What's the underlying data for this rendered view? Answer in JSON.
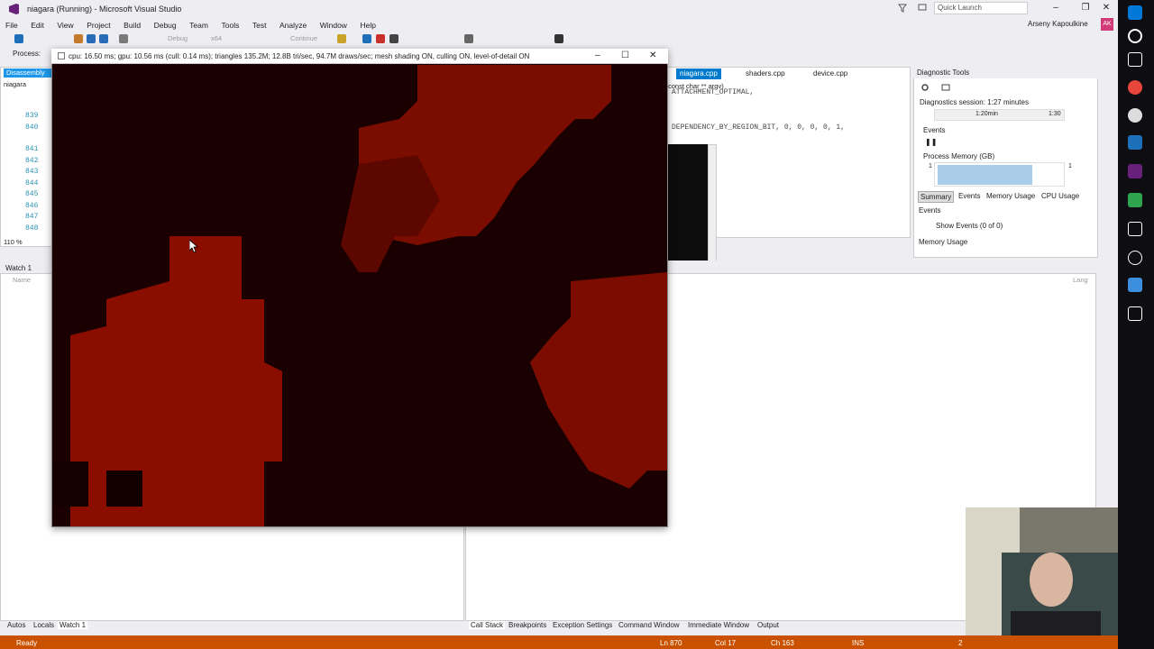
{
  "window": {
    "title": "niagara (Running) - Microsoft Visual Studio",
    "quick_launch": "Quick Launch",
    "user": "Arseny Kapoulkine",
    "user_initials": "AK"
  },
  "menu": [
    "File",
    "Edit",
    "View",
    "Project",
    "Build",
    "Debug",
    "Team",
    "Tools",
    "Test",
    "Analyze",
    "Window",
    "Help"
  ],
  "toolbar": {
    "config": "Debug",
    "platform": "x64",
    "continue": "Continue",
    "process_label": "Process:"
  },
  "left_doc": {
    "tab": "Disassembly",
    "file": "niagara",
    "lines": [
      "839",
      "840",
      "841",
      "842",
      "843",
      "844",
      "845",
      "846",
      "847",
      "848"
    ],
    "zoom": "110 %"
  },
  "editor": {
    "tabs": [
      "niagara.cpp",
      "shaders.cpp",
      "device.cpp"
    ],
    "scope": "const char ** argv)",
    "code_line1": "ATTACHMENT_OPTIMAL,",
    "code_line2": "DEPENDENCY_BY_REGION_BIT, 0, 0, 0, 0, 1,"
  },
  "diagnostics": {
    "title": "Diagnostic Tools",
    "session": "Diagnostics session: 1:27 minutes",
    "tick1": "1:20min",
    "tick2": "1:30",
    "events_label": "Events",
    "memory_label": "Process Memory (GB)",
    "mem_max": "1",
    "tabs": [
      "Summary",
      "Events",
      "Memory Usage",
      "CPU Usage"
    ],
    "events_header": "Events",
    "show_events": "Show Events (0 of 0)",
    "memory_header": "Memory Usage"
  },
  "game_window": {
    "title": "cpu: 16.50 ms; gpu: 10.56 ms (cull: 0.14 ms); triangles 135.2M; 12.8B tri/sec, 94.7M draws/sec; mesh shading ON, culling ON, level-of-detail ON"
  },
  "watch": {
    "title": "Watch 1",
    "col_name": "Name",
    "col_lang": "Lang"
  },
  "bottom_tabs_left": [
    "Autos",
    "Locals",
    "Watch 1"
  ],
  "bottom_tabs_right": [
    "Call Stack",
    "Breakpoints",
    "Exception Settings",
    "Command Window",
    "Immediate Window",
    "Output"
  ],
  "status": {
    "ready": "Ready",
    "line": "Ln 870",
    "col": "Col 17",
    "ch": "Ch 163",
    "mode": "INS",
    "notif": "2"
  },
  "colors": {
    "accent": "#1c97ea",
    "status_bar": "#ca5100",
    "game_bg": "#1e0000"
  }
}
